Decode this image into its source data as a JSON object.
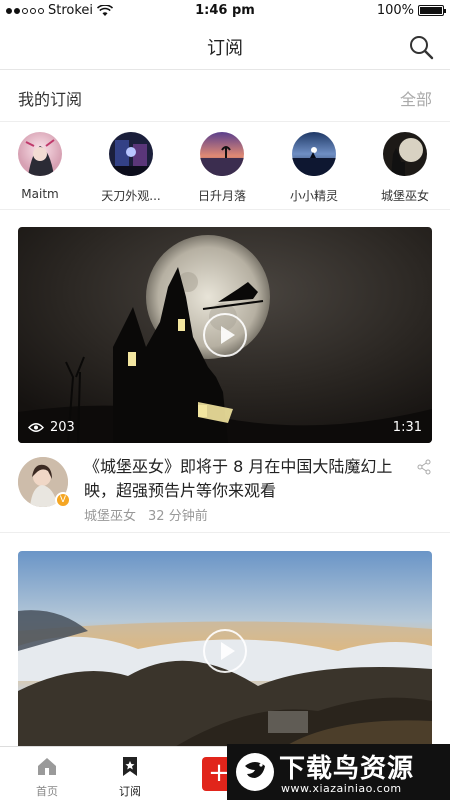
{
  "status_bar": {
    "carrier": "Strokei",
    "time": "1:46 pm",
    "battery": "100%"
  },
  "nav": {
    "title": "订阅",
    "search_icon": "search-icon"
  },
  "my_subscriptions": {
    "label": "我的订阅",
    "all_link": "全部"
  },
  "subscriptions": [
    {
      "name": "Maitm"
    },
    {
      "name": "天刀外观..."
    },
    {
      "name": "日升月落"
    },
    {
      "name": "小小精灵"
    },
    {
      "name": "城堡巫女"
    }
  ],
  "feed": [
    {
      "views": "203",
      "duration": "1:31",
      "title": "《城堡巫女》即将于 8 月在中国大陆魔幻上映，超强预告片等你来观看",
      "author": "城堡巫女",
      "time": "32 分钟前"
    }
  ],
  "tab_bar": [
    {
      "label": "首页",
      "icon": "home-icon"
    },
    {
      "label": "订阅",
      "icon": "bookmark-icon"
    },
    {
      "label": "+",
      "icon": "add-icon"
    }
  ],
  "watermark": {
    "name": "下载鸟资源",
    "url": "www.xiazainiao.com"
  },
  "colors": {
    "accent": "#e1251b",
    "badge": "#f5a623"
  }
}
